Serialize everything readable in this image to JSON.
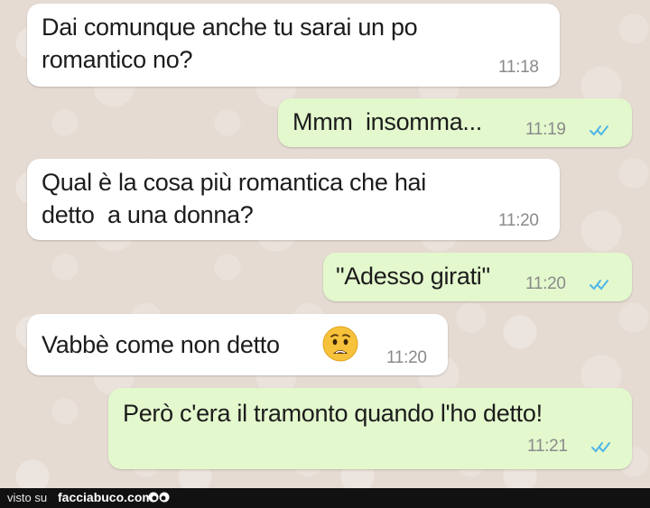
{
  "messages": [
    {
      "direction": "incoming",
      "text_line1": "Dai comunque anche tu sarai un po",
      "text_line2": "romantico no?",
      "time": "11:18"
    },
    {
      "direction": "outgoing",
      "text": "Mmm  insomma...",
      "time": "11:19",
      "status": "read"
    },
    {
      "direction": "incoming",
      "text_line1": "Qual è la cosa più romantica che hai",
      "text_line2": "detto  a una donna?",
      "time": "11:20"
    },
    {
      "direction": "outgoing",
      "text": "\"Adesso girati\"",
      "time": "11:20",
      "status": "read"
    },
    {
      "direction": "incoming",
      "text": "Vabbè come non detto",
      "emoji": "worried-face-icon",
      "time": "11:20"
    },
    {
      "direction": "outgoing",
      "text": "Però c'era il tramonto quando l'ho detto!",
      "time": "11:21",
      "status": "read"
    }
  ],
  "footer": {
    "visto_su": "visto su",
    "brand": "facciabuco.com"
  },
  "colors": {
    "incoming_bubble": "#ffffff",
    "outgoing_bubble": "#e3f8cd",
    "chat_background": "#e6dbd3",
    "read_ticks": "#4fb6e6",
    "timestamp": "#8a8a8a",
    "footer_bg": "#111111"
  }
}
